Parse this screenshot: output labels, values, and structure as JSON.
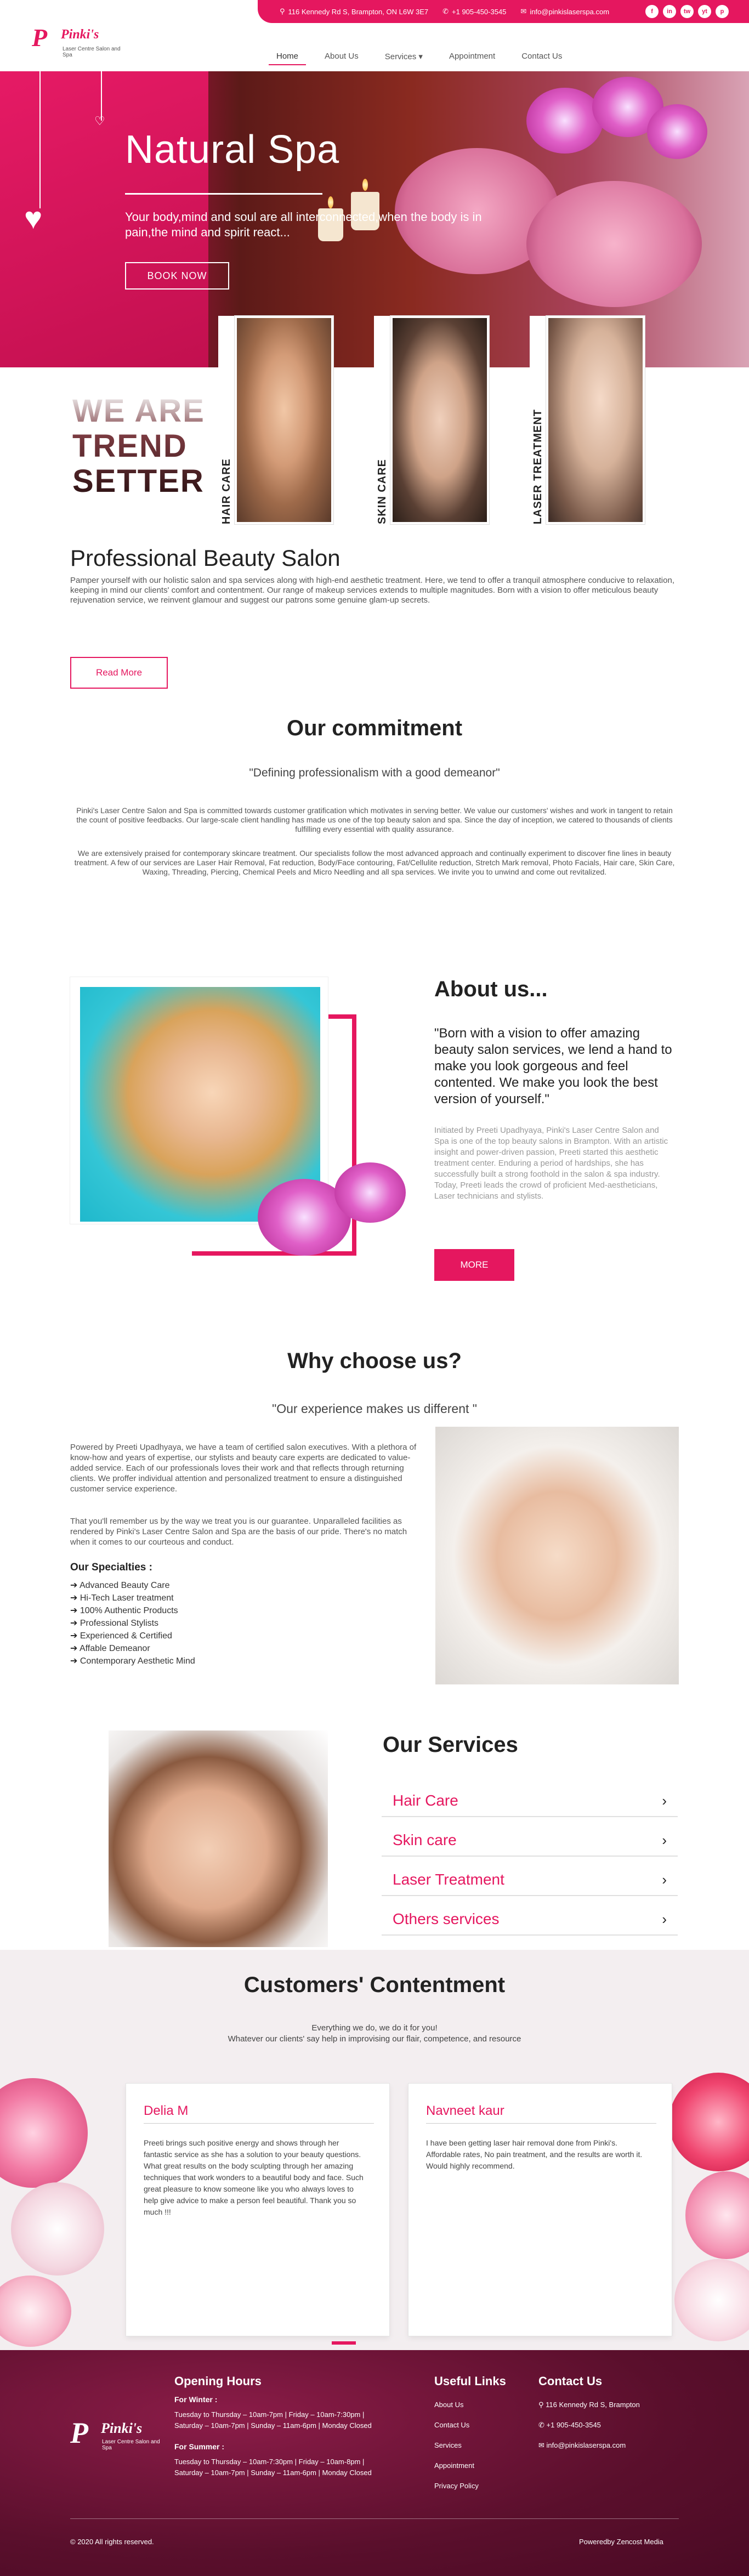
{
  "header": {
    "address": "116 Kennedy Rd S, Brampton, ON L6W 3E7",
    "phone": "+1 905-450-3545",
    "email": "info@pinkislaserspa.com",
    "social": [
      "f",
      "in",
      "tw",
      "yt",
      "p"
    ],
    "logo_mark": "P",
    "logo_name": "Pinki's",
    "logo_tagline": "Laser Centre Salon and Spa"
  },
  "nav": {
    "items": [
      "Home",
      "About Us",
      "Services",
      "Appointment",
      "Contact Us"
    ],
    "active": "Home"
  },
  "hero": {
    "title": "Natural Spa",
    "subtitle": "Your body,mind and soul are all interconnected,when the body is in pain,the mind and spirit react...",
    "button": "BOOK NOW"
  },
  "trend": {
    "line1": "WE ARE",
    "line2": "TREND",
    "line3": "SETTER",
    "cards": [
      "HAIR CARE",
      "SKIN CARE",
      "LASER TREATMENT"
    ]
  },
  "professional": {
    "title": "Professional Beauty Salon",
    "text": "Pamper yourself with our holistic salon and spa services along with high-end aesthetic treatment. Here, we tend to offer a tranquil atmosphere conducive to relaxation, keeping in mind our clients' comfort and contentment. Our range of makeup services extends to multiple magnitudes. Born with a vision to offer meticulous beauty rejuvenation service, we reinvent glamour and suggest our patrons some genuine glam-up secrets.",
    "button": "Read More"
  },
  "commitment": {
    "title": "Our commitment",
    "quote": "\"Defining professionalism with a good demeanor\"",
    "p1": "Pinki's Laser Centre Salon and Spa is committed towards customer gratification which motivates in serving better. We value our customers' wishes and work in tangent to retain the count of positive feedbacks. Our large-scale client handling has made us one of the top beauty salon and spa. Since the day of inception, we catered to thousands of clients fulfilling every essential with quality assurance.",
    "p2": "We are extensively praised for contemporary skincare treatment. Our specialists follow the most advanced approach and continually experiment to discover fine lines in beauty treatment. A few of our services are Laser Hair Removal, Fat reduction, Body/Face contouring, Fat/Cellulite reduction, Stretch Mark removal, Photo Facials, Hair care, Skin Care, Waxing, Threading, Piercing, Chemical Peels and Micro Needling and all spa services. We invite you to unwind and come out revitalized."
  },
  "about": {
    "title": "About us...",
    "quote": "\"Born with a vision to offer amazing beauty salon services, we lend a hand to make you look gorgeous and feel contented. We make you look the best version of yourself.\"",
    "text": "Initiated by Preeti Upadhyaya, Pinki's Laser Centre Salon and Spa is one of the top beauty salons in Brampton. With an artistic insight and power-driven passion, Preeti started this aesthetic treatment center. Enduring a period of hardships, she has successfully built a strong foothold in the salon & spa industry. Today, Preeti leads the crowd of proficient Med-aestheticians, Laser technicians and stylists.",
    "button": "MORE"
  },
  "why": {
    "title": "Why choose us?",
    "quote": "\"Our experience makes us different \"",
    "p1": "Powered by Preeti Upadhyaya, we have a team of certified salon executives. With a plethora of know-how and years of expertise, our stylists and beauty care experts are dedicated to value-added service. Each of our professionals loves their work and that reflects through returning clients. We proffer individual attention and personalized treatment to ensure a distinguished customer service experience.",
    "p2": "That you'll remember us by the way we treat you is our guarantee. Unparalleled facilities as rendered by Pinki's Laser Centre Salon and Spa are the basis of our pride. There's no match when it comes to our courteous and conduct.",
    "spec_title": "Our Specialties :",
    "specialties": [
      "Advanced Beauty Care",
      "Hi-Tech Laser treatment",
      "100% Authentic Products",
      "Professional Stylists",
      "Experienced & Certified",
      "Affable Demeanor",
      "Contemporary Aesthetic Mind"
    ]
  },
  "services": {
    "title": "Our Services",
    "items": [
      "Hair Care",
      "Skin care",
      "Laser Treatment",
      "Others services"
    ]
  },
  "testimonials": {
    "title": "Customers' Contentment",
    "sub1": "Everything we do, we do it for you!",
    "sub2": "Whatever our clients' say help in improvising our flair, competence, and resource",
    "items": [
      {
        "name": "Delia M",
        "text": "Preeti brings such positive energy and shows through her fantastic service as she has a solution to your beauty questions. What great results on the body sculpting through her amazing techniques that work wonders to a beautiful body and face. Such great pleasure to know someone like you who always loves to help give advice to make a person feel beautiful. Thank you so much !!!"
      },
      {
        "name": "Navneet kaur",
        "text": "I have been getting laser hair removal done from Pinki's. Affordable rates, No pain treatment, and the results are worth it. Would highly recommend."
      }
    ]
  },
  "footer": {
    "hours_title": "Opening Hours",
    "winter_label": "For Winter :",
    "winter_1": "Tuesday to Thursday – 10am-7pm | Friday – 10am-7:30pm |",
    "winter_2": "Saturday – 10am-7pm | Sunday – 11am-6pm | Monday Closed",
    "summer_label": "For Summer :",
    "summer_1": "Tuesday to Thursday – 10am-7:30pm | Friday – 10am-8pm |",
    "summer_2": "Saturday – 10am-7pm | Sunday – 11am-6pm | Monday Closed",
    "links_title": "Useful Links",
    "links": [
      "About Us",
      "Contact Us",
      "Services",
      "Appointment",
      "Privacy Policy"
    ],
    "contact_title": "Contact Us",
    "contact_address": "116 Kennedy Rd S, Brampton",
    "contact_phone": "+1 905-450-3545",
    "contact_email": "info@pinkislaserspa.com",
    "copyright": "© 2020 All rights reserved.",
    "powered": "Poweredby Zencost Media"
  },
  "colors": {
    "accent": "#e5175f",
    "footer": "#5a0f2c"
  }
}
